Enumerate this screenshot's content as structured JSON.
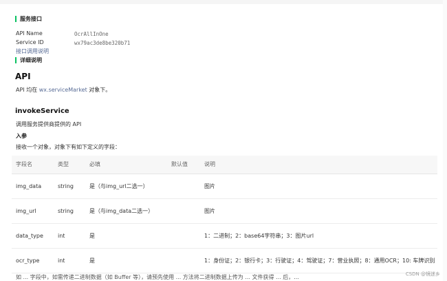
{
  "service_section": {
    "title": "服务接口",
    "api_name_label": "API Name",
    "api_name_value": "OcrAllInOne",
    "service_id_label": "Service ID",
    "service_id_value": "wx79ac3de8be320b71",
    "doc_link": "接口调用说明"
  },
  "detail_section": {
    "title": "详细说明"
  },
  "api": {
    "heading": "API",
    "desc_prefix": "API 均在 ",
    "desc_link": "wx.serviceMarket",
    "desc_suffix": " 对象下。"
  },
  "invoke": {
    "heading": "invokeService",
    "desc": "调用服务提供商提供的 API",
    "params_title": "入参",
    "params_desc": "接收一个对象，对象下有如下定义的字段："
  },
  "table": {
    "headers": [
      "字段名",
      "类型",
      "必填",
      "默认值",
      "说明"
    ],
    "rows": [
      [
        "img_data",
        "string",
        "是（与img_url二选一）",
        "",
        "图片"
      ],
      [
        "img_url",
        "string",
        "是（与img_data二选一）",
        "",
        "图片"
      ],
      [
        "data_type",
        "int",
        "是",
        "",
        "1：二进制；2：base64字符串；3：图片url"
      ],
      [
        "ocr_type",
        "int",
        "是",
        "",
        "1：身份证；2：银行卡；3：行驶证；4：驾驶证；7：营业执照；8：通用OCR；10: 车牌识别"
      ]
    ]
  },
  "bottom_text": "如 ... 字段中，如需传递二进制数据（如 Buffer 等），请预先使用 ... 方法将二进制数据上传为 ... 文件获得 ... 后，...",
  "watermark": "CSDN @镜迷乡"
}
